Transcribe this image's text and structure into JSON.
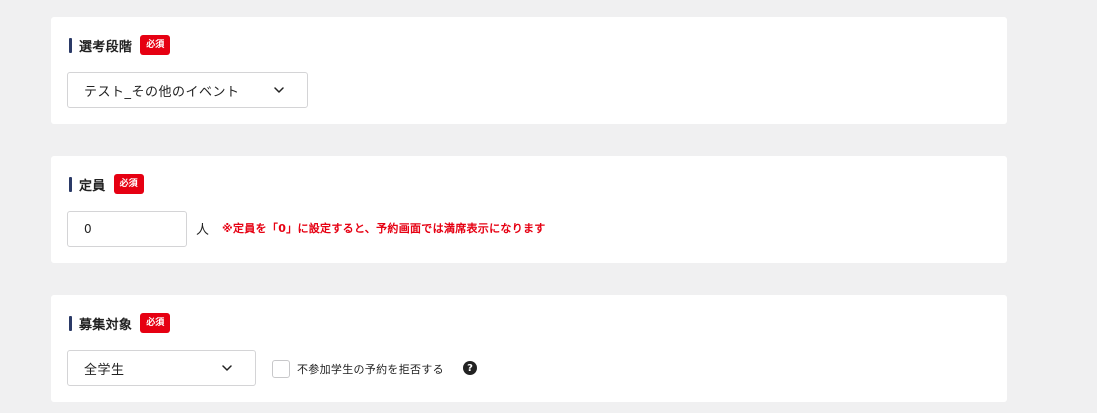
{
  "sections": [
    {
      "label": "選考段階",
      "required_badge": "必須",
      "select": {
        "value": "テスト_その他のイベント",
        "icon": "chevron-down-icon"
      }
    },
    {
      "label": "定員",
      "required_badge": "必須",
      "input": {
        "value": "0"
      },
      "unit": "人",
      "note": "※定員を「0」に設定すると、予約画面では満席表示になります"
    },
    {
      "label": "募集対象",
      "required_badge": "必須",
      "select": {
        "value": "全学生",
        "icon": "chevron-down-icon"
      },
      "checkbox": {
        "label": "不参加学生の予約を拒否する",
        "checked": false
      },
      "help_icon": "?"
    }
  ],
  "colors": {
    "accent_bar": "#2b3a67",
    "required_badge": "#e60012",
    "note_text": "#e60012",
    "page_bg": "#f0f0f1"
  }
}
